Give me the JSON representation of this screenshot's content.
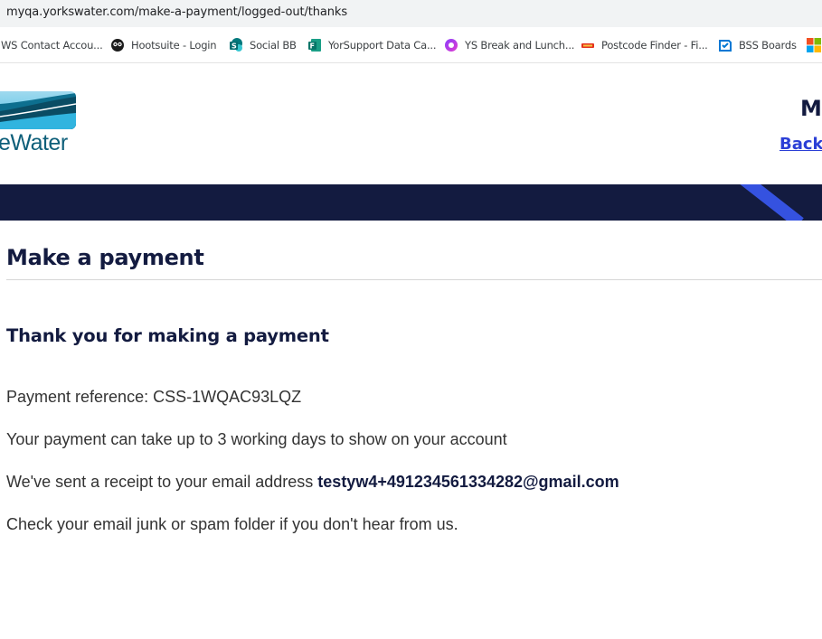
{
  "browser": {
    "url": "myqa.yorkswater.com/make-a-payment/logged-out/thanks",
    "bookmarks": [
      {
        "label": "WS Contact Accou...",
        "icon": "none"
      },
      {
        "label": "Hootsuite - Login",
        "icon": "owl-icon"
      },
      {
        "label": "Social BB",
        "icon": "sharepoint-icon"
      },
      {
        "label": "YorSupport Data Ca...",
        "icon": "forms-icon"
      },
      {
        "label": "YS Break and Lunch...",
        "icon": "loop-icon"
      },
      {
        "label": "Postcode Finder - Fi...",
        "icon": "royal-mail-icon"
      },
      {
        "label": "BSS Boards",
        "icon": "azure-boards-icon"
      }
    ]
  },
  "header": {
    "logo_text": "eWater",
    "right_heading": "M",
    "back_link": "Back"
  },
  "page": {
    "title": "Make a payment",
    "thanks_heading": "Thank you for making a payment",
    "payment_reference": "Payment reference: CSS-1WQAC93LQZ",
    "processing_note": "Your payment can take up to 3 working days to show on your account",
    "receipt_prefix": "We've sent a receipt to your email address",
    "receipt_email": "testyw4+491234561334282@gmail.com",
    "junk_note": "Check your email junk or spam folder if you don't hear from us."
  },
  "colors": {
    "navy": "#131b40",
    "link": "#2b3fd6",
    "stripe": "#3552e0"
  }
}
